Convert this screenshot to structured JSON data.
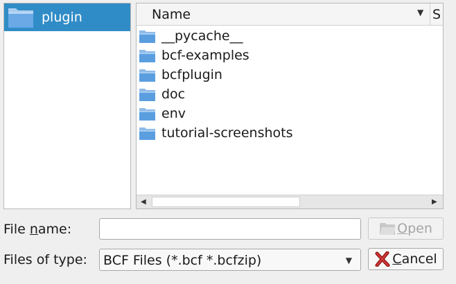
{
  "sidebar": {
    "items": [
      {
        "label": "plugin",
        "icon": "folder-icon"
      }
    ]
  },
  "file_list": {
    "columns": {
      "name": "Name",
      "size_partial": "S"
    },
    "sort": "descending",
    "rows": [
      {
        "name": "__pycache__",
        "icon": "folder-icon"
      },
      {
        "name": "bcf-examples",
        "icon": "folder-icon"
      },
      {
        "name": "bcfplugin",
        "icon": "folder-icon"
      },
      {
        "name": "doc",
        "icon": "folder-icon"
      },
      {
        "name": "env",
        "icon": "folder-icon"
      },
      {
        "name": "tutorial-screenshots",
        "icon": "folder-icon"
      }
    ]
  },
  "form": {
    "file_name": {
      "label_pre": "File ",
      "label_mnemonic": "n",
      "label_post": "ame:",
      "value": ""
    },
    "file_type": {
      "label": "Files of type:",
      "value": "BCF Files (*.bcf *.bcfzip)"
    }
  },
  "buttons": {
    "open": {
      "label": "Open",
      "mnemonic": "O",
      "rest": "pen",
      "enabled": false
    },
    "cancel": {
      "label": "Cancel",
      "mnemonic": "C",
      "rest": "ancel"
    }
  },
  "colors": {
    "selection": "#308cc6",
    "folder": "#5a9ee0"
  }
}
